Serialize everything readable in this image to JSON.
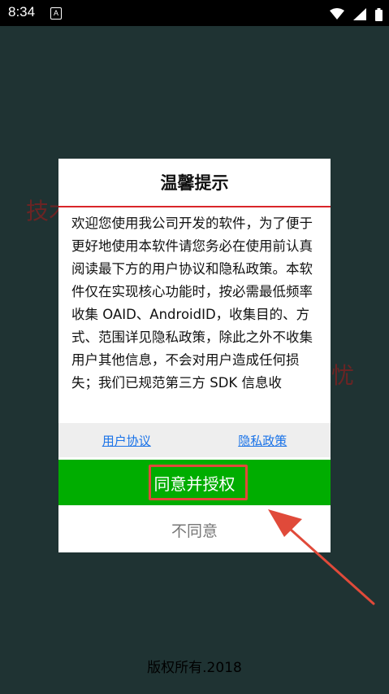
{
  "status_bar": {
    "time": "8:34",
    "notification_glyph": "A",
    "icons": [
      "wifi-icon",
      "signal-icon",
      "battery-icon"
    ]
  },
  "background": {
    "left_text": "技术",
    "right_text": "忧",
    "copyright": "版权所有.2018"
  },
  "dialog": {
    "title": "温馨提示",
    "body": "欢迎您使用我公司开发的软件，为了便于更好地使用本软件请您务必在使用前认真阅读最下方的用户协议和隐私政策。本软件仅在实现核心功能时，按必需最低频率收集 OAID、AndroidID，收集目的、方式、范围详见隐私政策，除此之外不收集用户其他信息，不会对用户造成任何损失；我们已规范第三方 SDK 信息收",
    "links": {
      "user_agreement": "用户协议",
      "privacy_policy": "隐私政策"
    },
    "agree_label": "同意并授权",
    "disagree_label": "不同意"
  },
  "colors": {
    "background": "#1f3333",
    "agree_button": "#00ad00",
    "header_rule": "#d9252a",
    "link": "#1a73e8",
    "annotation": "#e04a3a"
  }
}
